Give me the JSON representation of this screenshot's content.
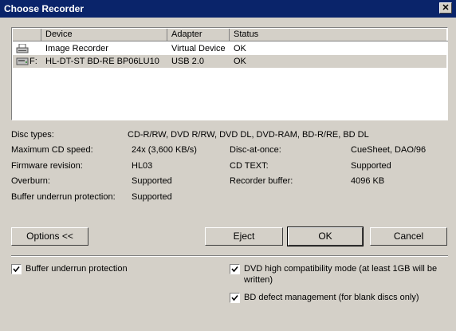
{
  "window": {
    "title": "Choose Recorder",
    "close_glyph": "✕"
  },
  "devices": {
    "columns": [
      "Device",
      "Adapter",
      "Status"
    ],
    "rows": [
      {
        "drive": "",
        "device": "Image Recorder",
        "adapter": "Virtual Device",
        "status": "OK",
        "icon": "printer-icon"
      },
      {
        "drive": "F:",
        "device": "HL-DT-ST BD-RE BP06LU10",
        "adapter": "USB 2.0",
        "status": "OK",
        "icon": "optical-drive-icon"
      }
    ]
  },
  "info": {
    "disc_types_label": "Disc types:",
    "disc_types_value": "CD-R/RW, DVD R/RW, DVD DL, DVD-RAM, BD-R/RE, BD DL",
    "max_cd_speed_label": "Maximum CD speed:",
    "max_cd_speed_value": "24x (3,600 KB/s)",
    "firmware_label": "Firmware revision:",
    "firmware_value": "HL03",
    "overburn_label": "Overburn:",
    "overburn_value": "Supported",
    "buffer_underrun_label": "Buffer underrun protection:",
    "buffer_underrun_value": "Supported",
    "disc_at_once_label": "Disc-at-once:",
    "disc_at_once_value": "CueSheet, DAO/96",
    "cd_text_label": "CD TEXT:",
    "cd_text_value": "Supported",
    "recorder_buffer_label": "Recorder buffer:",
    "recorder_buffer_value": "4096 KB"
  },
  "buttons": {
    "options": "Options <<",
    "eject": "Eject",
    "ok": "OK",
    "cancel": "Cancel"
  },
  "options": {
    "buffer_underrun": {
      "label": "Buffer underrun protection",
      "checked": true
    },
    "dvd_compat": {
      "label_line1": "DVD high compatibility mode (at least 1GB will be",
      "label_line2": "written)",
      "checked": true
    },
    "bd_defect": {
      "label": "BD defect management (for blank discs only)",
      "checked": true
    }
  }
}
